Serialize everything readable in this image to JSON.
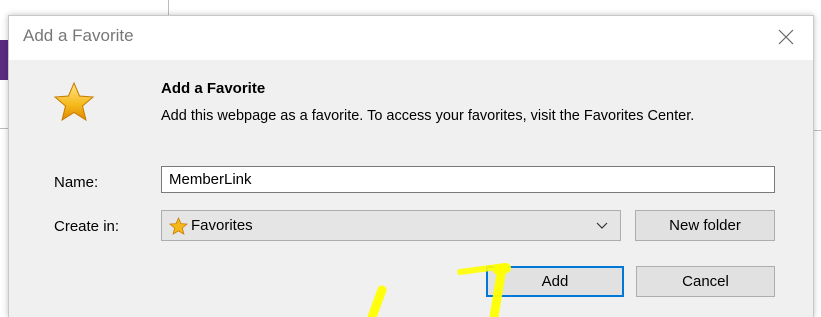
{
  "dialog": {
    "title": "Add a Favorite",
    "header_title": "Add a Favorite",
    "header_description": "Add this webpage as a favorite. To access your favorites, visit the Favorites Center."
  },
  "form": {
    "name_label": "Name:",
    "name_value": "MemberLink",
    "create_in_label": "Create in:",
    "create_in_selected": "Favorites"
  },
  "buttons": {
    "new_folder": "New folder",
    "add": "Add",
    "cancel": "Cancel"
  },
  "colors": {
    "star": "#f5b81a",
    "focus_border": "#0078d7",
    "annotation": "#ffff00"
  },
  "icons": {
    "header": "star-icon",
    "folder": "favorites-star-icon",
    "close": "close-icon",
    "dropdown": "chevron-down-icon"
  }
}
